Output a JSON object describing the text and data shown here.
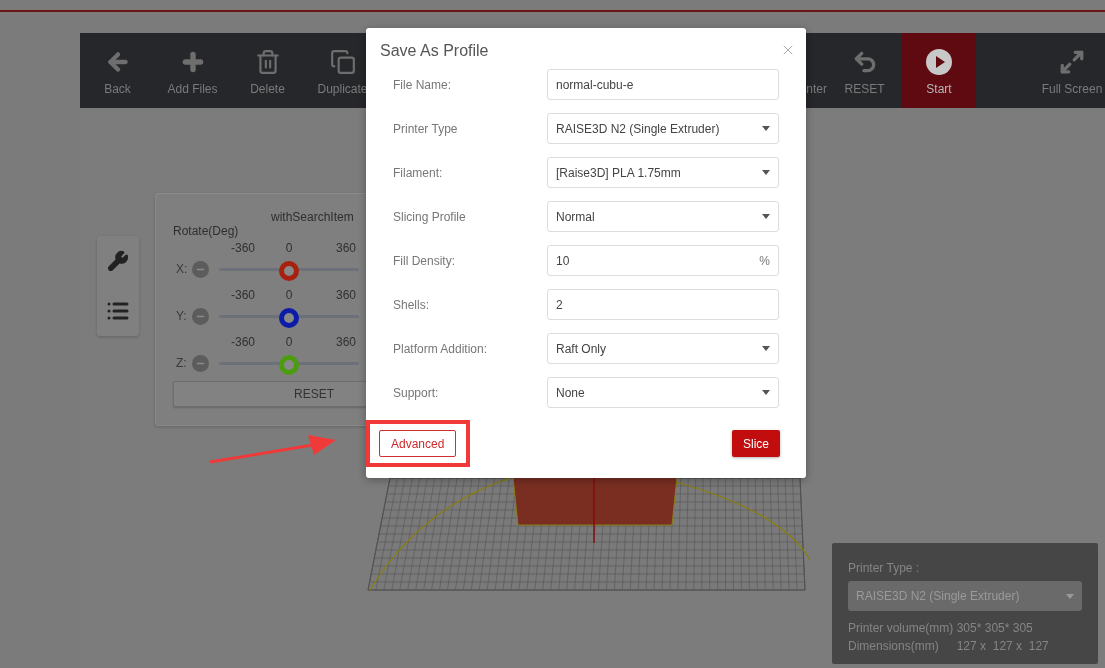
{
  "toolbar": {
    "items": [
      {
        "label": "Back",
        "kind": "back",
        "active": false
      },
      {
        "label": "Add Files",
        "kind": "add",
        "active": false
      },
      {
        "label": "Delete",
        "kind": "delete",
        "active": false
      },
      {
        "label": "Duplicate",
        "kind": "duplicate",
        "active": false
      },
      {
        "label": "nter",
        "kind": "center",
        "active": false
      },
      {
        "label": "RESET",
        "kind": "reset",
        "active": false
      },
      {
        "label": "Start",
        "kind": "start",
        "active": true
      },
      {
        "label": "Full Screen",
        "kind": "fullscreen",
        "active": false
      }
    ]
  },
  "rotate_panel": {
    "search_label": "withSearchItem",
    "title": "Rotate(Deg)",
    "axes": [
      {
        "axis": "X:",
        "min": "-360",
        "mid": "0",
        "max": "360",
        "level": 0.5,
        "color": "#a8200e"
      },
      {
        "axis": "Y:",
        "min": "-360",
        "mid": "0",
        "max": "360",
        "level": 0.5,
        "color": "#0c1ca8"
      },
      {
        "axis": "Z:",
        "min": "-360",
        "mid": "0",
        "max": "360",
        "level": 0.5,
        "color": "#4c9c10"
      }
    ],
    "reset": "RESET"
  },
  "dialog": {
    "title": "Save As Profile",
    "fields": [
      {
        "label": "File Name:",
        "kind": "input",
        "value": "normal-cubu-e"
      },
      {
        "label": "Printer Type",
        "kind": "select",
        "value": "RAISE3D N2 (Single Extruder)"
      },
      {
        "label": "Filament:",
        "kind": "select",
        "value": "[Raise3D] PLA 1.75mm"
      },
      {
        "label": "Slicing Profile",
        "kind": "select",
        "value": "Normal"
      },
      {
        "label": "Fill Density:",
        "kind": "input",
        "value": "10",
        "unit": "%"
      },
      {
        "label": "Shells:",
        "kind": "input",
        "value": "2"
      },
      {
        "label": "Platform Addition:",
        "kind": "select",
        "value": "Raft Only"
      },
      {
        "label": "Support:",
        "kind": "select",
        "value": "None"
      }
    ],
    "advanced": "Advanced",
    "slice": "Slice"
  },
  "printer_panel": {
    "label": "Printer Type :",
    "printer": "RAISE3D N2 (Single Extruder)",
    "volume": "Printer volume(mm) 305* 305* 305",
    "dimensions_label": "Dimensions(mm)",
    "dimensions": "127 x  127 x  127"
  }
}
